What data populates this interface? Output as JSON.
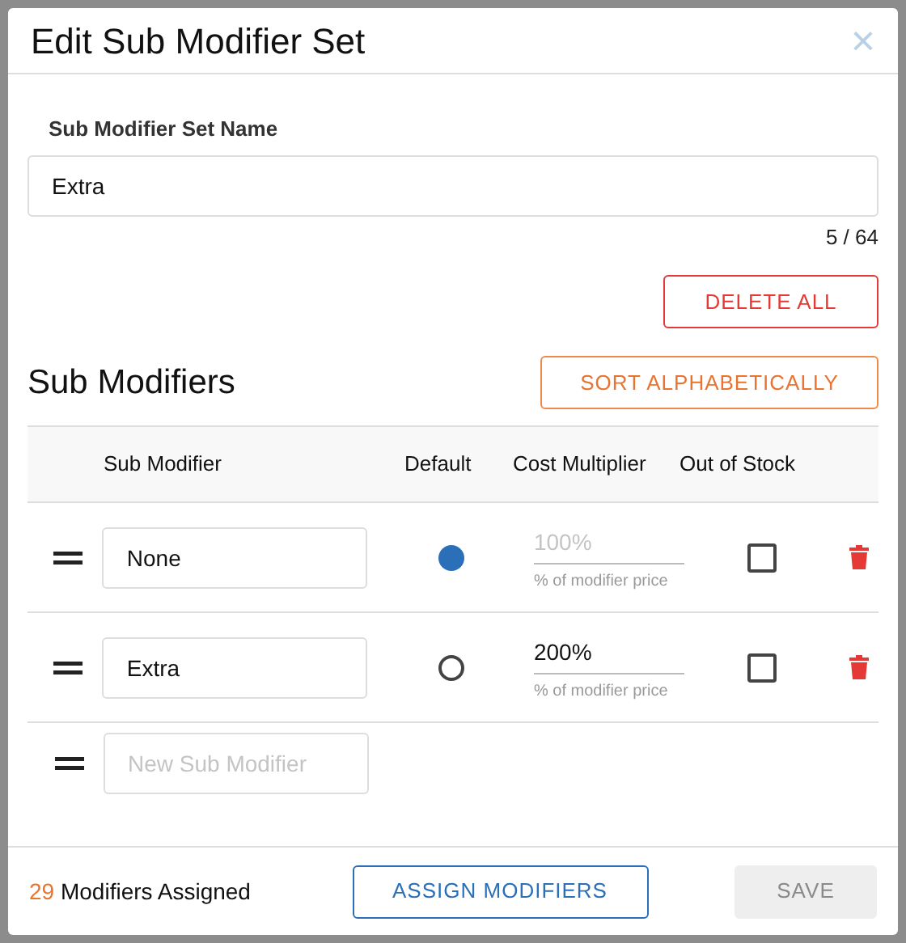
{
  "dialog": {
    "title": "Edit Sub Modifier Set",
    "close": "×"
  },
  "name_field": {
    "label": "Sub Modifier Set Name",
    "value": "Extra",
    "counter": "5 / 64"
  },
  "delete_all": "DELETE ALL",
  "section_title": "Sub Modifiers",
  "sort_button": "SORT ALPHABETICALLY",
  "table": {
    "columns": [
      "Sub Modifier",
      "Default",
      "Cost Multiplier",
      "Out of Stock"
    ],
    "rows": [
      {
        "name": "None",
        "default": true,
        "cost": "100%",
        "cost_hint": "% of modifier price",
        "cost_disabled": true,
        "out_of_stock": false
      },
      {
        "name": "Extra",
        "default": false,
        "cost": "200%",
        "cost_hint": "% of modifier price",
        "cost_disabled": false,
        "out_of_stock": false
      }
    ],
    "new_row": {
      "placeholder": "New Sub Modifier"
    }
  },
  "footer": {
    "count": "29",
    "count_label": "Modifiers Assigned",
    "assign_button": "ASSIGN MODIFIERS",
    "save_button": "SAVE",
    "save_disabled": true
  }
}
